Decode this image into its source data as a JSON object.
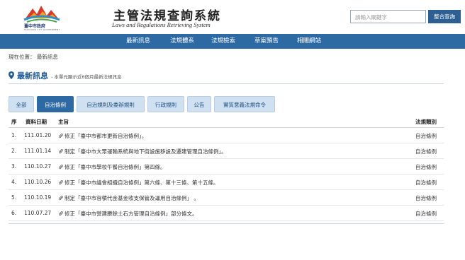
{
  "header": {
    "logo_name": "臺中市政府",
    "logo_sub": "TAICHUNG CITY GOVERNMENT",
    "title_zh": "主管法規查詢系統",
    "title_en": "Laws and Regulations Retrieving System",
    "search_placeholder": "請輸入關鍵字",
    "search_button": "整合查詢"
  },
  "nav": {
    "items": [
      "最新訊息",
      "法規體系",
      "法規檢索",
      "草案預告",
      "相關網站"
    ]
  },
  "breadcrumb": "現在位置： 最新訊息",
  "section": {
    "title": "最新訊息",
    "subtitle": "- 本單元顯示近6個月最新法規訊息"
  },
  "tabs": [
    "全部",
    "自治條例",
    "自治規則及委辦規則",
    "行政規則",
    "公告",
    "實質意義法規命令"
  ],
  "active_tab": "自治條例",
  "table": {
    "headers": {
      "seq": "序",
      "date": "資料日期",
      "subject": "主旨",
      "category": "法規類別"
    },
    "rows": [
      {
        "seq": "1.",
        "date": "111.01.20",
        "subject": "修正「臺中市都市更新自治條例」。",
        "category": "自治條例"
      },
      {
        "seq": "2.",
        "date": "111.01.14",
        "subject": "制定「臺中市大眾運輸系統與地下街設施移設及遷建管理自治條例」。",
        "category": "自治條例"
      },
      {
        "seq": "3.",
        "date": "110.10.27",
        "subject": "修正「臺中市學校午餐自治條例」第四條。",
        "category": "自治條例"
      },
      {
        "seq": "4.",
        "date": "110.10.26",
        "subject": "修正「臺中市議會組織自治條例」第六條、第十三條、第十五條。",
        "category": "自治條例"
      },
      {
        "seq": "5.",
        "date": "110.10.19",
        "subject": "制定「臺中市容積代金基金收支保管及運用自治條例」 。",
        "category": "自治條例"
      },
      {
        "seq": "6.",
        "date": "110.07.27",
        "subject": "修正「臺中市營建賸餘土石方管理自治條例」部分條文。",
        "category": "自治條例"
      }
    ]
  },
  "colors": {
    "primary": "#2d6aa3",
    "tab_bg": "#cfe0f1",
    "title": "#1f5a94"
  }
}
